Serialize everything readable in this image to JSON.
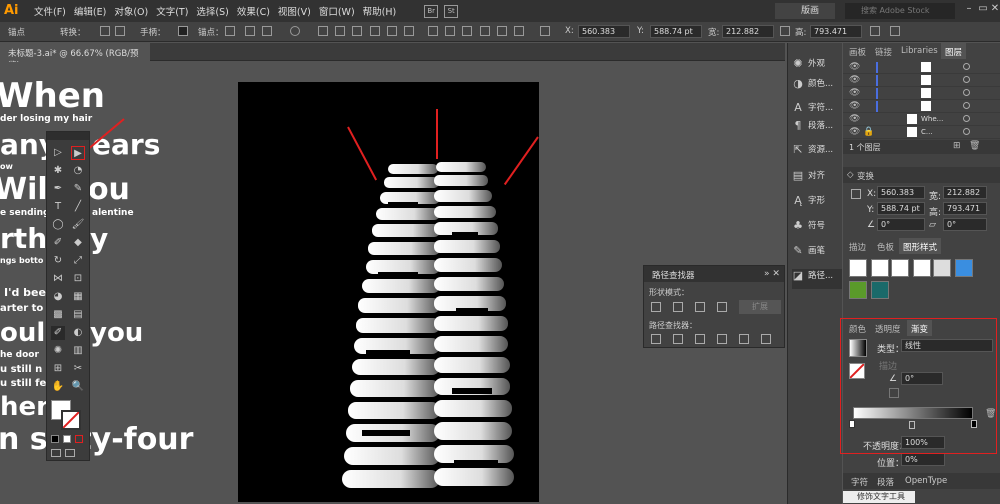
{
  "app": {
    "logo": "Ai"
  },
  "menu": [
    "文件(F)",
    "编辑(E)",
    "对象(O)",
    "文字(T)",
    "选择(S)",
    "效果(C)",
    "视图(V)",
    "窗口(W)",
    "帮助(H)"
  ],
  "menubar_extra": {
    "br": "Br",
    "st": "St",
    "workspace": "版画",
    "search_placeholder": "搜索 Adobe Stock"
  },
  "control_bar": {
    "label": "锚点",
    "convert": "转换：",
    "handle": "手柄：",
    "anchor": "锚点：",
    "x_label": "X:",
    "x_value": "560.383",
    "y_label": "Y:",
    "y_value": "588.74 pt",
    "w_label": "宽:",
    "w_value": "212.882",
    "h_label": "高:",
    "h_value": "793.471"
  },
  "document": {
    "tab_title": "未标题-3.ai* @ 66.67% (RGB/预览)"
  },
  "artwork_text": [
    "When",
    "der losing my hair",
    "any",
    "ears",
    "ow",
    "Will you",
    "e sending",
    "alentine",
    "rthd",
    "y",
    "ngs botto",
    "I'd been",
    "arter to t",
    "ould",
    "you",
    "he door",
    "u still n",
    "u still fe",
    "hen",
    "n sixty-four"
  ],
  "pathfinder": {
    "title": "路径查找器",
    "shape_modes": "形状模式：",
    "expand": "扩展",
    "pathfinders": "路径查找器："
  },
  "dock": [
    {
      "icon": "appearance-icon",
      "label": "外观"
    },
    {
      "icon": "color-icon",
      "label": "颜色..."
    },
    {
      "icon": "character-icon",
      "label": "字符..."
    },
    {
      "icon": "paragraph-icon",
      "label": "段落..."
    },
    {
      "icon": "assets-icon",
      "label": "资源..."
    },
    {
      "icon": "align-icon",
      "label": "对齐"
    },
    {
      "icon": "transform-icon",
      "label": "字形"
    },
    {
      "icon": "symbols-icon",
      "label": "符号"
    },
    {
      "icon": "brushes-icon",
      "label": "画笔"
    },
    {
      "icon": "pathfinder-icon",
      "label": "路径..."
    }
  ],
  "layers_panel": {
    "tabs": [
      "画板",
      "链接",
      "Libraries",
      "图层"
    ],
    "rows": [
      "",
      "",
      "",
      "",
      "Whe...",
      "C..."
    ],
    "footer": "1 个图层"
  },
  "transform_panel": {
    "title": "变换",
    "x_label": "X:",
    "x_value": "560.383",
    "y_label": "Y:",
    "y_value": "588.74 pt",
    "w_label": "宽:",
    "w_value": "212.882",
    "h_label": "高:",
    "h_value": "793.471",
    "angle1": "0°",
    "angle2": "0°"
  },
  "styles_panel": {
    "tabs": [
      "描边",
      "色板",
      "图形样式"
    ]
  },
  "gradient_panel": {
    "tabs": [
      "颜色",
      "透明度",
      "渐变"
    ],
    "type_label": "类型：",
    "type_value": "线性",
    "stroke_label": "描边",
    "angle_value": "0°",
    "opacity_label": "不透明度：",
    "opacity_value": "100%",
    "location_label": "位置：",
    "location_value": "0%"
  },
  "bottom_tabs": [
    "字符",
    "段落",
    "OpenType"
  ],
  "tooltip": "修饰文字工具",
  "colors": {
    "accent_red": "#e02020",
    "brand_orange": "#ff9a00"
  }
}
